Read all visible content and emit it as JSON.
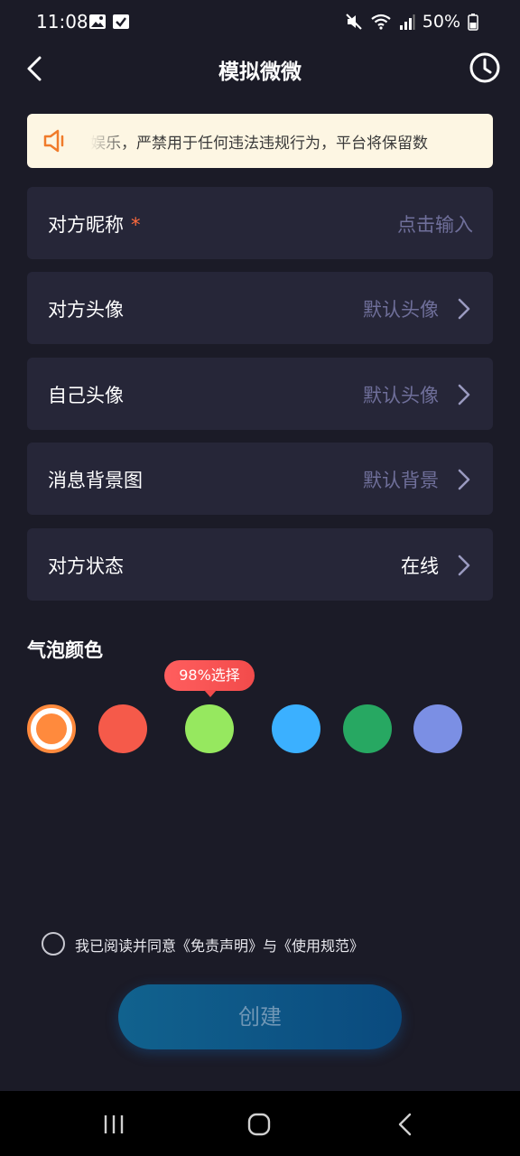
{
  "status_bar": {
    "time": "11:08",
    "battery": "50%"
  },
  "header": {
    "title": "模拟微微"
  },
  "notice": {
    "text": "娱乐，严禁用于任何违法违规行为，平台将保留数"
  },
  "form": {
    "rows": [
      {
        "label": "对方昵称",
        "required": "*",
        "value": "点击输入"
      },
      {
        "label": "对方头像",
        "value": "默认头像"
      },
      {
        "label": "自己头像",
        "value": "默认头像"
      },
      {
        "label": "消息背景图",
        "value": "默认背景"
      },
      {
        "label": "对方状态",
        "value": "在线"
      }
    ]
  },
  "bubble_color": {
    "title": "气泡颜色",
    "tip": "98%选择",
    "colors": [
      "#ff8a3d",
      "#f55a4a",
      "#96e85f",
      "#3bb0ff",
      "#27a862",
      "#7b8fe4"
    ],
    "selected_index": 0
  },
  "agreement": {
    "text": "我已阅读并同意《免责声明》与《使用规范》"
  },
  "create_button": {
    "label": "创建"
  }
}
